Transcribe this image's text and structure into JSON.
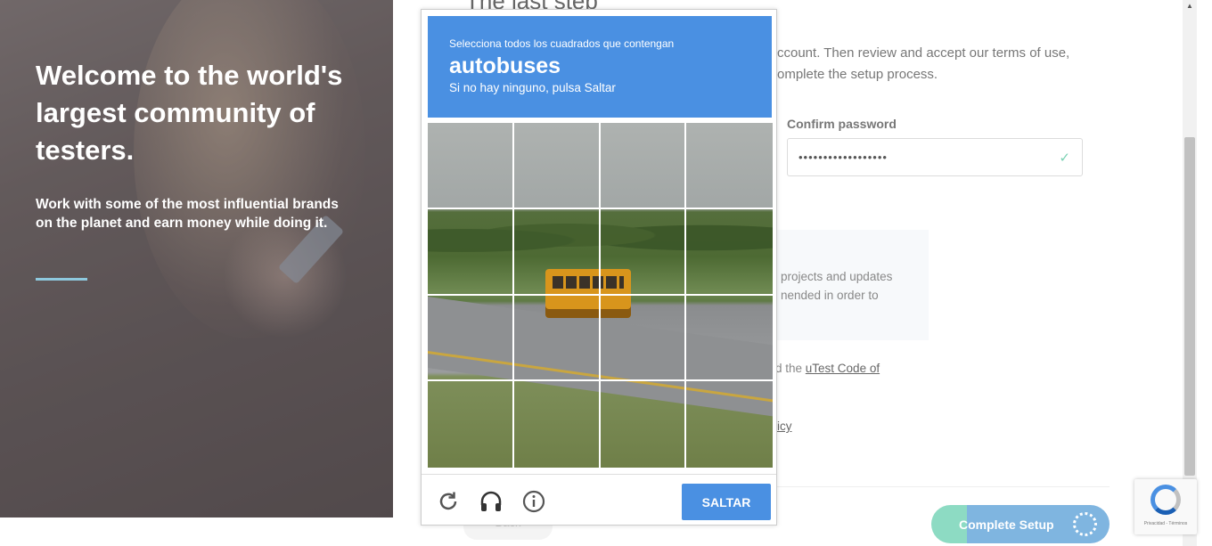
{
  "hero": {
    "heading": "Welcome to the world's largest community of testers.",
    "subtext": "Work with some of the most influential brands on the planet and earn money while doing it."
  },
  "page": {
    "title": "The last step",
    "intro": "ccount. Then review and accept our terms of use, omplete the setup process.",
    "confirm_label": "Confirm password",
    "confirm_value": "••••••••••••••••••",
    "info_text": "projects and updates nended in order to",
    "code_prefix": "d the ",
    "code_link": "uTest Code of",
    "policy_fragment": "icy",
    "back_label": "Back",
    "complete_label": "Complete Setup"
  },
  "captcha": {
    "instruction": "Selecciona todos los cuadrados que contengan",
    "keyword": "autobuses",
    "hint": "Si no hay ninguno, pulsa Saltar",
    "skip_label": "SALTAR",
    "icons": [
      "reload-icon",
      "headphones-icon",
      "info-icon"
    ],
    "grid": {
      "rows": 4,
      "cols": 4
    }
  },
  "recaptcha_badge": {
    "text": "Privacidad - Términos"
  },
  "colors": {
    "captcha_blue": "#4a90e2",
    "accent_green": "#8ddbc3",
    "hero_rule": "#8ec9de"
  }
}
